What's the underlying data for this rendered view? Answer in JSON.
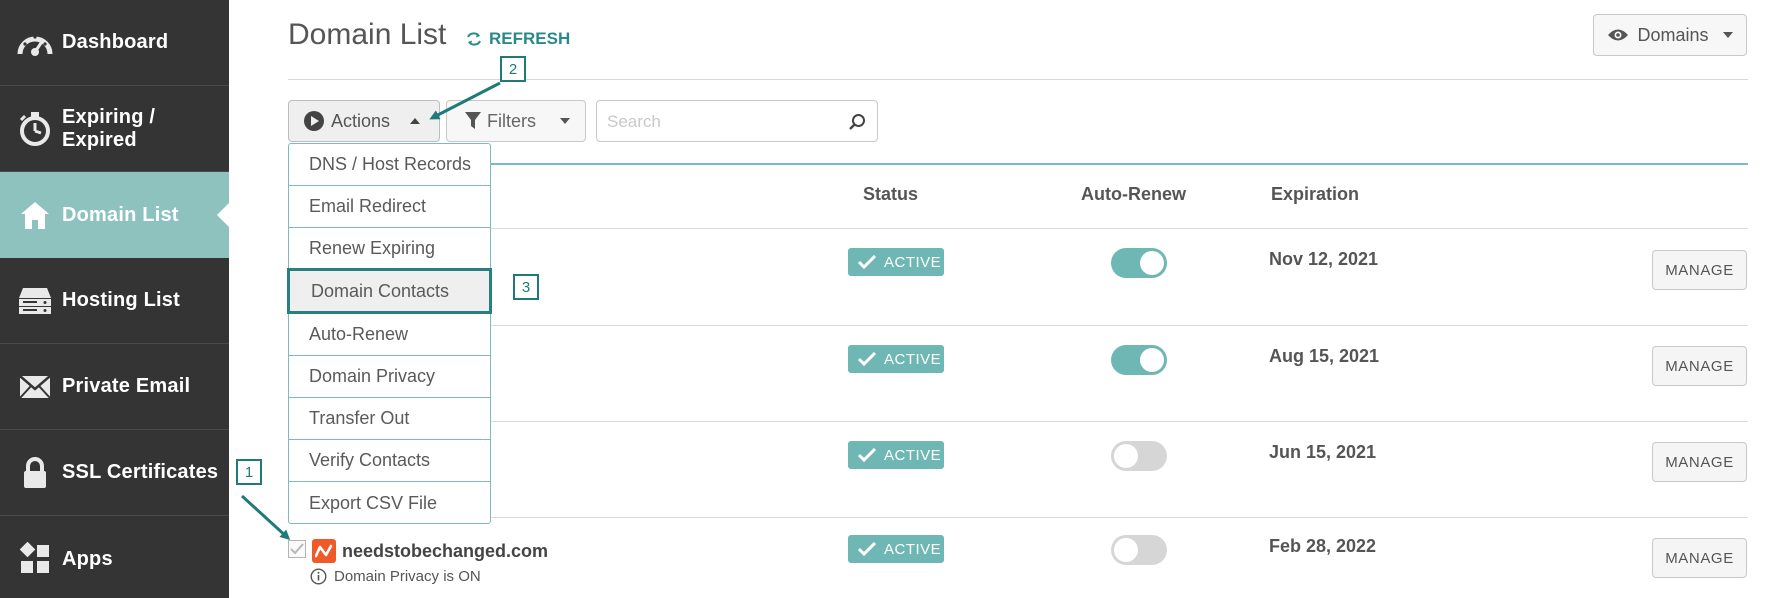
{
  "sidebar": {
    "items": [
      {
        "label": "Dashboard",
        "icon": "dashboard-gauge-icon"
      },
      {
        "label": "Expiring / Expired",
        "icon": "stopwatch-icon"
      },
      {
        "label": "Domain List",
        "icon": "home-icon",
        "active": true
      },
      {
        "label": "Hosting List",
        "icon": "server-icon"
      },
      {
        "label": "Private Email",
        "icon": "envelope-icon"
      },
      {
        "label": "SSL Certificates",
        "icon": "lock-icon"
      },
      {
        "label": "Apps",
        "icon": "apps-grid-icon"
      }
    ]
  },
  "header": {
    "title": "Domain List",
    "refresh_label": "REFRESH",
    "view_selector_label": "Domains"
  },
  "toolbar": {
    "actions_label": "Actions",
    "filters_label": "Filters",
    "search_placeholder": "Search"
  },
  "actions_menu": {
    "items": [
      "DNS / Host Records",
      "Email Redirect",
      "Renew Expiring",
      "Domain Contacts",
      "Auto-Renew",
      "Domain Privacy",
      "Transfer Out",
      "Verify Contacts",
      "Export CSV File"
    ],
    "highlighted": "Domain Contacts"
  },
  "table": {
    "columns": [
      "Status",
      "Auto-Renew",
      "Expiration"
    ],
    "manage_label": "MANAGE",
    "rows": [
      {
        "status": "ACTIVE",
        "auto_renew": true,
        "expiration": "Nov 12, 2021"
      },
      {
        "status": "ACTIVE",
        "auto_renew": true,
        "expiration": "Aug 15, 2021"
      },
      {
        "status": "ACTIVE",
        "auto_renew": false,
        "expiration": "Jun 15, 2021"
      },
      {
        "status": "ACTIVE",
        "auto_renew": false,
        "expiration": "Feb 28, 2022",
        "domain": "needstobechanged.com",
        "note": "Domain Privacy is ON",
        "checked": true
      }
    ]
  },
  "annotations": {
    "callouts": [
      "1",
      "2",
      "3"
    ]
  },
  "colors": {
    "sidebar_bg": "#343434",
    "active_bg": "#8ec2bf",
    "accent": "#6fb7b5",
    "annotation": "#1f7a7a"
  }
}
